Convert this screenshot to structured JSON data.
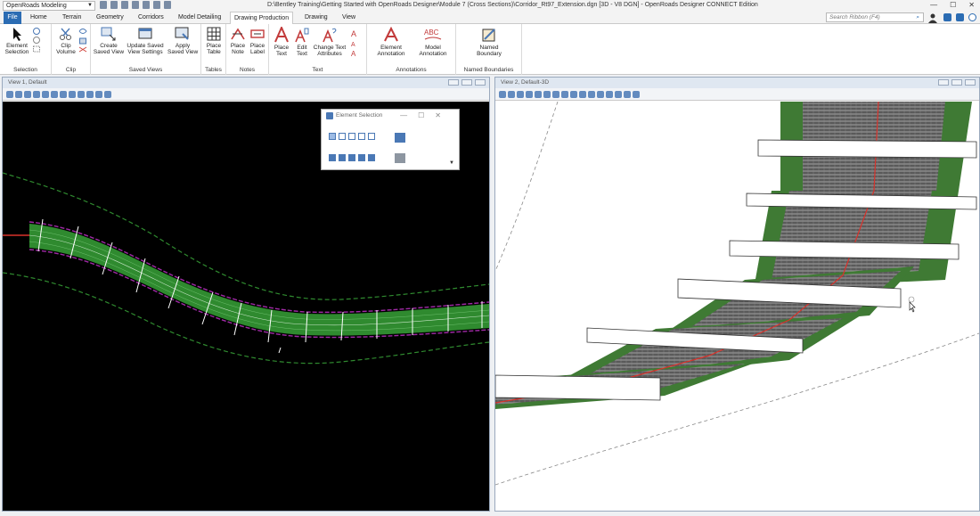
{
  "app": {
    "workspace": "OpenRoads Modeling",
    "title": "D:\\Bentley Training\\Getting Started with OpenRoads Designer\\Module 7 (Cross Sections)\\Corridor_Rt97_Extension.dgn [3D - V8 DGN] - OpenRoads Designer CONNECT Edition"
  },
  "tabs": [
    "File",
    "Home",
    "Terrain",
    "Geometry",
    "Corridors",
    "Model Detailing",
    "Drawing Production",
    "Drawing",
    "View"
  ],
  "active_tab": "Drawing Production",
  "search": {
    "placeholder": "Search Ribbon (F4)"
  },
  "ribbon": {
    "groups": [
      {
        "label": "Selection",
        "buttons": [
          "Element\nSelection"
        ]
      },
      {
        "label": "Clip",
        "buttons": [
          "Clip\nVolume"
        ]
      },
      {
        "label": "Saved Views",
        "buttons": [
          "Create\nSaved View",
          "Update Saved\nView Settings",
          "Apply\nSaved View"
        ]
      },
      {
        "label": "Tables",
        "buttons": [
          "Place\nTable"
        ]
      },
      {
        "label": "Notes",
        "buttons": [
          "Place\nNote",
          "Place\nLabel"
        ]
      },
      {
        "label": "Text",
        "buttons": [
          "Place\nText",
          "Edit\nText",
          "Change Text\nAttributes"
        ]
      },
      {
        "label": "Annotations",
        "buttons": [
          "Element\nAnnotation",
          "Model\nAnnotation"
        ]
      },
      {
        "label": "Named Boundaries",
        "buttons": [
          "Named\nBoundary"
        ]
      }
    ]
  },
  "views": {
    "left": {
      "title": "View 1, Default"
    },
    "right": {
      "title": "View 2, Default-3D"
    }
  },
  "element_selection": {
    "title": "Element Selection"
  },
  "colors": {
    "accent": "#2b6cb3",
    "road_green": "#2f8a2f",
    "centerline": "#d9322b",
    "boundary": "#a02aa6"
  }
}
